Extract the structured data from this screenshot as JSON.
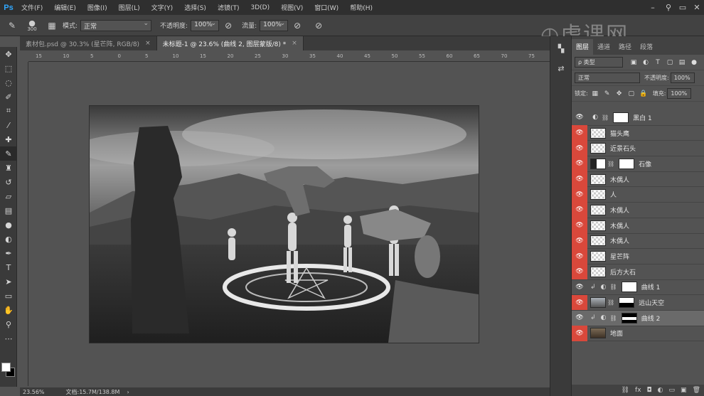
{
  "app": {
    "logo": "Ps"
  },
  "menu": [
    "文件(F)",
    "编辑(E)",
    "图像(I)",
    "图层(L)",
    "文字(Y)",
    "选择(S)",
    "滤镜(T)",
    "3D(D)",
    "视图(V)",
    "窗口(W)",
    "帮助(H)"
  ],
  "options": {
    "brush_size": "300",
    "mode_label": "模式:",
    "mode_value": "正常",
    "opacity_label": "不透明度:",
    "opacity_value": "100%",
    "flow_label": "流量:",
    "flow_value": "100%"
  },
  "tabs": [
    {
      "label": "素材包.psd @ 30.3% (星芒阵, RGB/8)",
      "active": false
    },
    {
      "label": "未标题-1 @ 23.6% (曲线 2, 图层蒙版/8) *",
      "active": true
    }
  ],
  "ruler_ticks": [
    "15",
    "10",
    "5",
    "0",
    "5",
    "10",
    "15",
    "20",
    "25",
    "30",
    "35",
    "40",
    "45",
    "50",
    "55",
    "60",
    "65",
    "70",
    "75"
  ],
  "status": {
    "zoom": "23.56%",
    "doc": "文档:15.7M/138.8M"
  },
  "panel": {
    "tabs": [
      "图层",
      "通道",
      "路径",
      "段落"
    ],
    "filter_label": "ρ 类型",
    "blend_mode": "正常",
    "opacity_label": "不透明度:",
    "opacity_value": "100%",
    "lock_label": "锁定:",
    "fill_label": "填充:",
    "fill_value": "100%"
  },
  "layers": [
    {
      "name": "黑白 1",
      "eye_red": false,
      "type": "adjustment",
      "selected": false
    },
    {
      "name": "猫头鹰",
      "eye_red": true,
      "type": "smart",
      "selected": false
    },
    {
      "name": "近景石头",
      "eye_red": true,
      "type": "smart",
      "selected": false
    },
    {
      "name": "石像",
      "eye_red": true,
      "type": "masked",
      "selected": false
    },
    {
      "name": "木偶人",
      "eye_red": true,
      "type": "smart",
      "selected": false
    },
    {
      "name": "人",
      "eye_red": true,
      "type": "smart",
      "selected": false
    },
    {
      "name": "木偶人",
      "eye_red": true,
      "type": "smart",
      "selected": false
    },
    {
      "name": "木偶人",
      "eye_red": true,
      "type": "smart",
      "selected": false
    },
    {
      "name": "木偶人",
      "eye_red": true,
      "type": "smart",
      "selected": false
    },
    {
      "name": "星芒阵",
      "eye_red": true,
      "type": "smart",
      "selected": false
    },
    {
      "name": "后方大石",
      "eye_red": true,
      "type": "smart",
      "selected": false
    },
    {
      "name": "曲线 1",
      "eye_red": false,
      "type": "curve",
      "selected": false
    },
    {
      "name": "远山天空",
      "eye_red": true,
      "type": "masked-sky",
      "selected": false
    },
    {
      "name": "曲线 2",
      "eye_red": false,
      "type": "curve2",
      "selected": true
    },
    {
      "name": "地面",
      "eye_red": true,
      "type": "land",
      "selected": false
    }
  ],
  "footer_icons": [
    "link-icon",
    "fx-icon",
    "mask-icon",
    "adjustment-icon",
    "folder-icon",
    "new-layer-icon",
    "trash-icon"
  ]
}
